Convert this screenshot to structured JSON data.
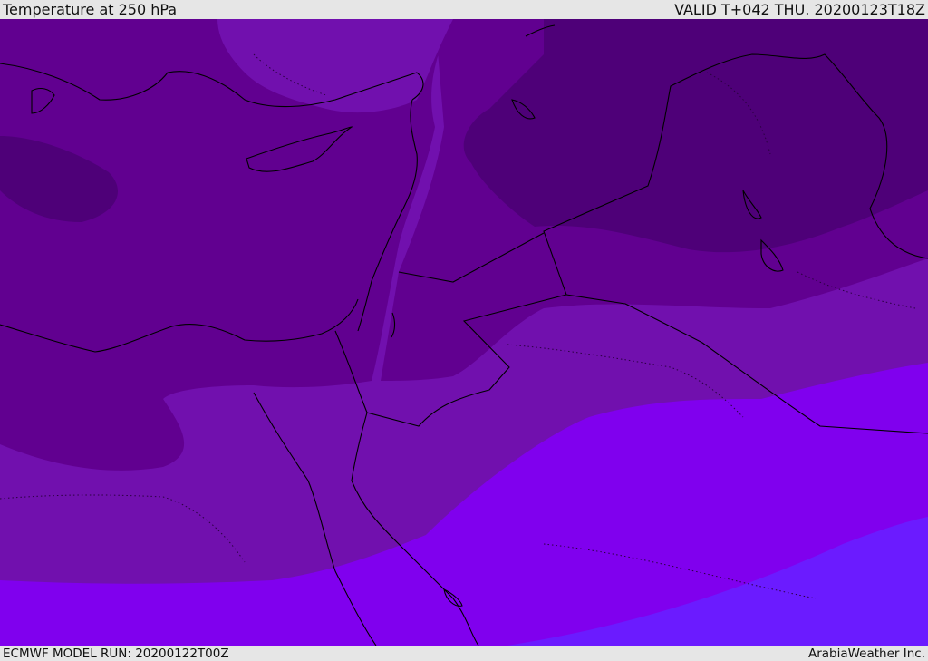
{
  "header": {
    "title": "Temperature at 250 hPa",
    "valid": "VALID T+042 THU. 20200123T18Z"
  },
  "footer": {
    "model_run": "ECMWF MODEL RUN: 20200122T00Z",
    "credit": "ArabiaWeather Inc."
  },
  "colors": {
    "band_coldest": "#4e0078",
    "band_cold": "#610090",
    "band_mid": "#7110ae",
    "band_warm": "#8000ee",
    "band_warmest": "#6b1bff",
    "coastline": "#000000"
  }
}
